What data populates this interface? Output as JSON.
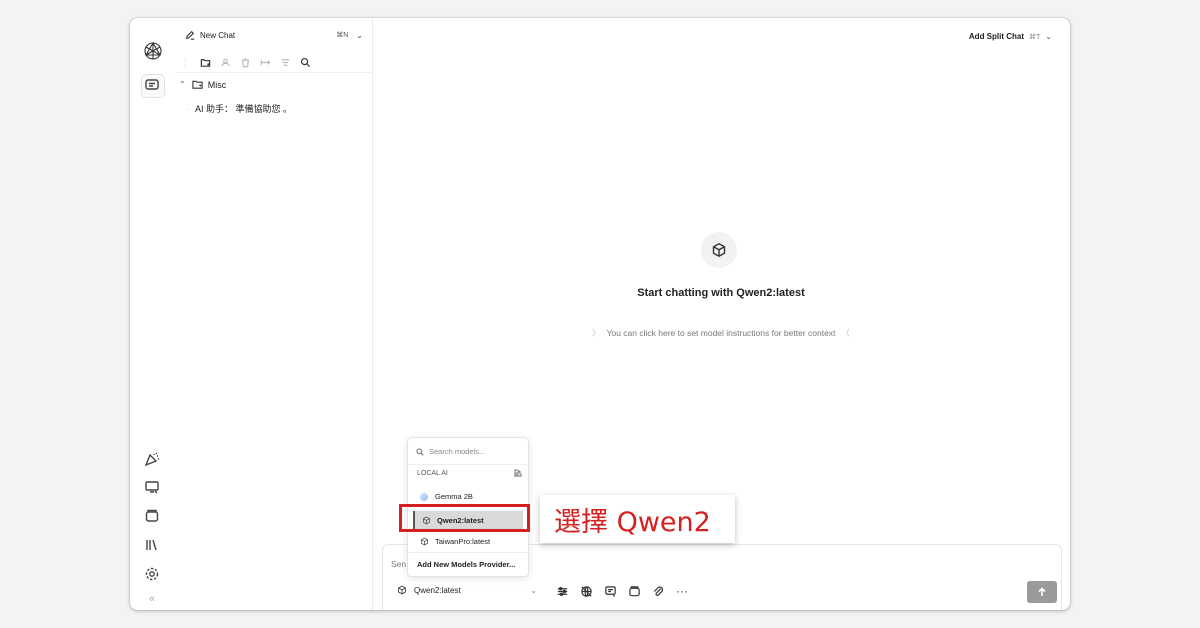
{
  "sidebar": {
    "new_chat_label": "New Chat",
    "new_chat_shortcut": "⌘N",
    "folder_name": "Misc",
    "chats": [
      {
        "title": "AI 助手： 準備協助您 。"
      }
    ]
  },
  "main": {
    "split_chat_label": "Add Split Chat",
    "split_chat_shortcut": "⌘T",
    "hero_title": "Start chatting with Qwen2:latest",
    "hero_subtitle": "You can click here to set model instructions for better context",
    "hero_subtitle_left": "〉",
    "hero_subtitle_right": "〈"
  },
  "composer": {
    "placeholder": "Sen",
    "selected_model": "Qwen2:latest",
    "more_label": "···"
  },
  "model_dropdown": {
    "search_placeholder": "Search models...",
    "section_label": "LOCAL AI",
    "models": [
      {
        "name": "Gemma 2B",
        "icon": "gemma-icon"
      },
      {
        "name": "Qwen2:latest",
        "icon": "cube-icon",
        "selected": true
      },
      {
        "name": "TaiwanPro:latest",
        "icon": "cube-icon"
      }
    ],
    "add_provider_label": "Add New Models Provider..."
  },
  "annotation": {
    "label": "選擇 Qwen2",
    "color": "#d42020"
  },
  "colors": {
    "traffic_red": "#ff5f57",
    "traffic_yellow": "#febc2e",
    "traffic_green": "#28c840",
    "send_button": "#9a9a9a"
  }
}
